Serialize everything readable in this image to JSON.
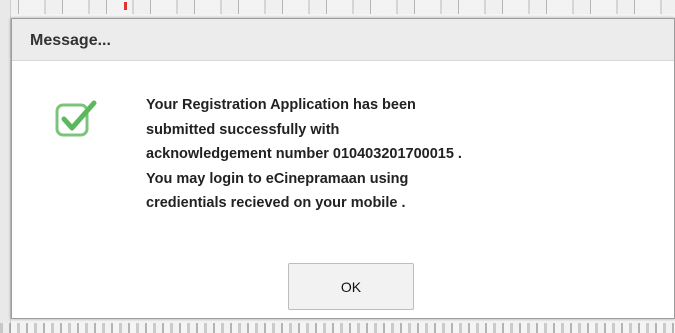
{
  "dialog": {
    "title": "Message...",
    "icon": "check-icon",
    "accent_color": "#5cb85c",
    "message_lines": [
      "Your Registration Application has been",
      "submitted successfully with",
      "acknowledgement number 010403201700015 .",
      "You may login to eCinepramaan using",
      "credientials recieved on your mobile ."
    ],
    "ok_label": "OK"
  }
}
